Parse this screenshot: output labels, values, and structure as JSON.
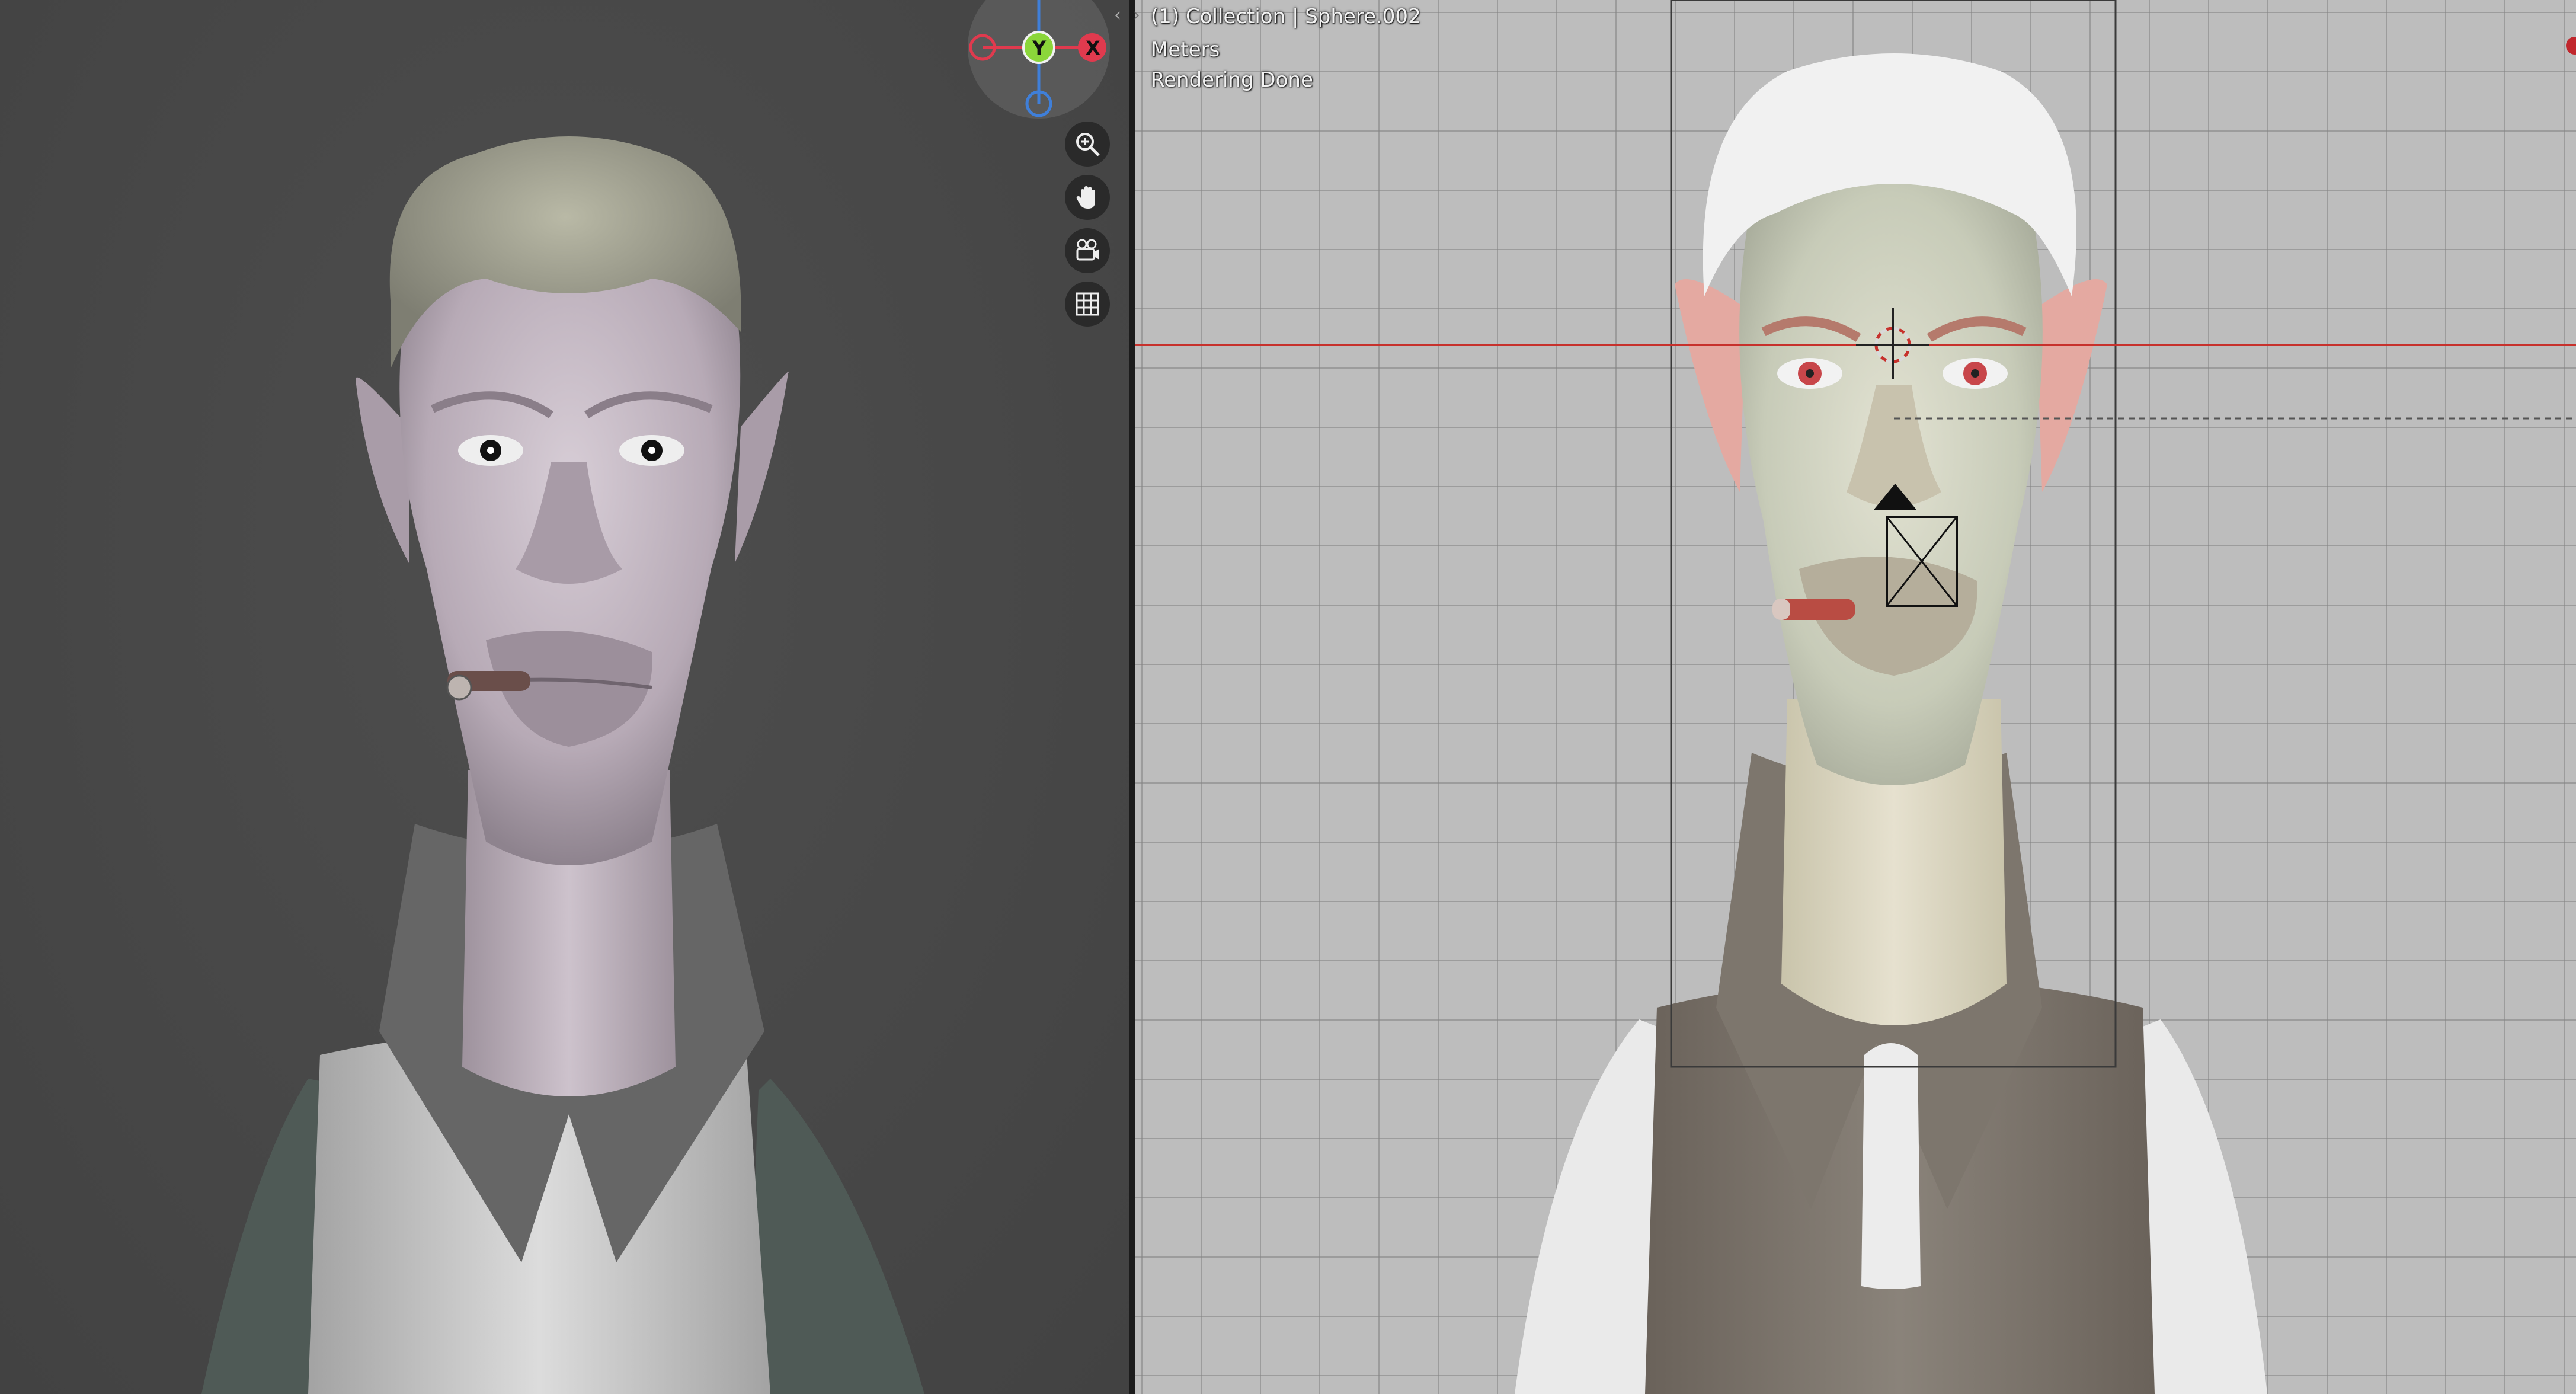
{
  "viewport_left": {
    "navigation": {
      "gizmo": {
        "y_label": "Y",
        "x_label": "X"
      },
      "buttons": [
        "zoom-icon",
        "hand-pan-icon",
        "camera-view-icon",
        "grid-ortho-icon"
      ]
    }
  },
  "viewport_right": {
    "overlay": {
      "object_info": "(1) Collection | Sphere.002",
      "units": "Meters",
      "status": "Rendering Done"
    }
  },
  "colors": {
    "axis_x": "#e03a4e",
    "axis_y": "#8bd63a",
    "axis_z": "#3f7fd9",
    "viewport_left_bg": "#474747",
    "viewport_right_bg": "#bdbdbd"
  }
}
